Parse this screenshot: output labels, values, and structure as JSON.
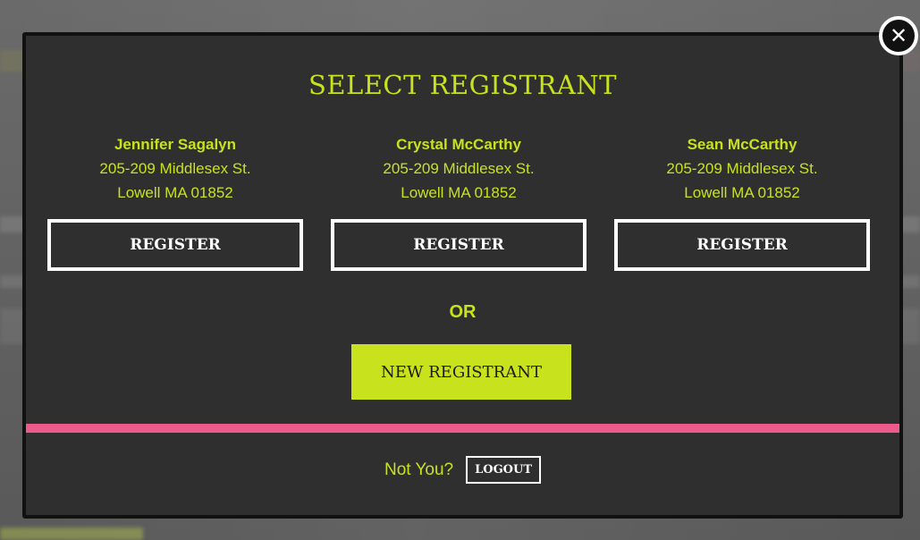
{
  "modal": {
    "title": "SELECT REGISTRANT",
    "close_icon": "close-icon",
    "registrants": [
      {
        "name": "Jennifer Sagalyn",
        "address_line1": "205-209 Middlesex St.",
        "address_line2": "Lowell MA 01852",
        "button_label": "REGISTER"
      },
      {
        "name": "Crystal McCarthy",
        "address_line1": "205-209 Middlesex St.",
        "address_line2": "Lowell MA 01852",
        "button_label": "REGISTER"
      },
      {
        "name": "Sean McCarthy",
        "address_line1": "205-209 Middlesex St.",
        "address_line2": "Lowell MA 01852",
        "button_label": "REGISTER"
      }
    ],
    "or_label": "OR",
    "new_registrant_label": "NEW REGISTRANT",
    "footer": {
      "not_you_label": "Not You?",
      "logout_label": "LOGOUT"
    }
  },
  "colors": {
    "accent": "#c8e21d",
    "modal_bg": "#2f2f2f",
    "divider": "#ec5b8a",
    "button_border": "#ffffff"
  }
}
